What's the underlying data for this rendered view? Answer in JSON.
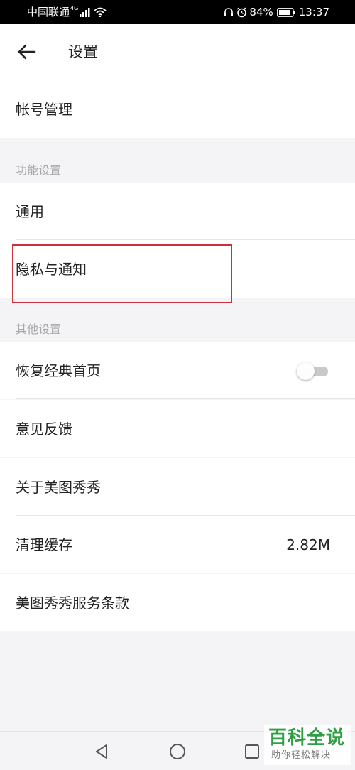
{
  "status_bar": {
    "carrier": "中国联通",
    "network": "4G",
    "battery": "84%",
    "time": "13:37"
  },
  "header": {
    "title": "设置",
    "back_icon": "arrow-left-icon"
  },
  "rows": {
    "account": "帐号管理",
    "general": "通用",
    "privacy": "隐私与通知",
    "restore_home": "恢复经典首页",
    "feedback": "意见反馈",
    "about": "关于美图秀秀",
    "clear_cache": "清理缓存",
    "cache_size": "2.82M",
    "terms": "美图秀秀服务条款"
  },
  "sections": {
    "function": "功能设置",
    "other": "其他设置"
  },
  "toggle": {
    "restore_home_on": false
  },
  "colors": {
    "highlight": "#c9323a",
    "watermark": "#2ea043"
  },
  "watermark": {
    "title": "百科全说",
    "subtitle": "助你轻松解决"
  }
}
